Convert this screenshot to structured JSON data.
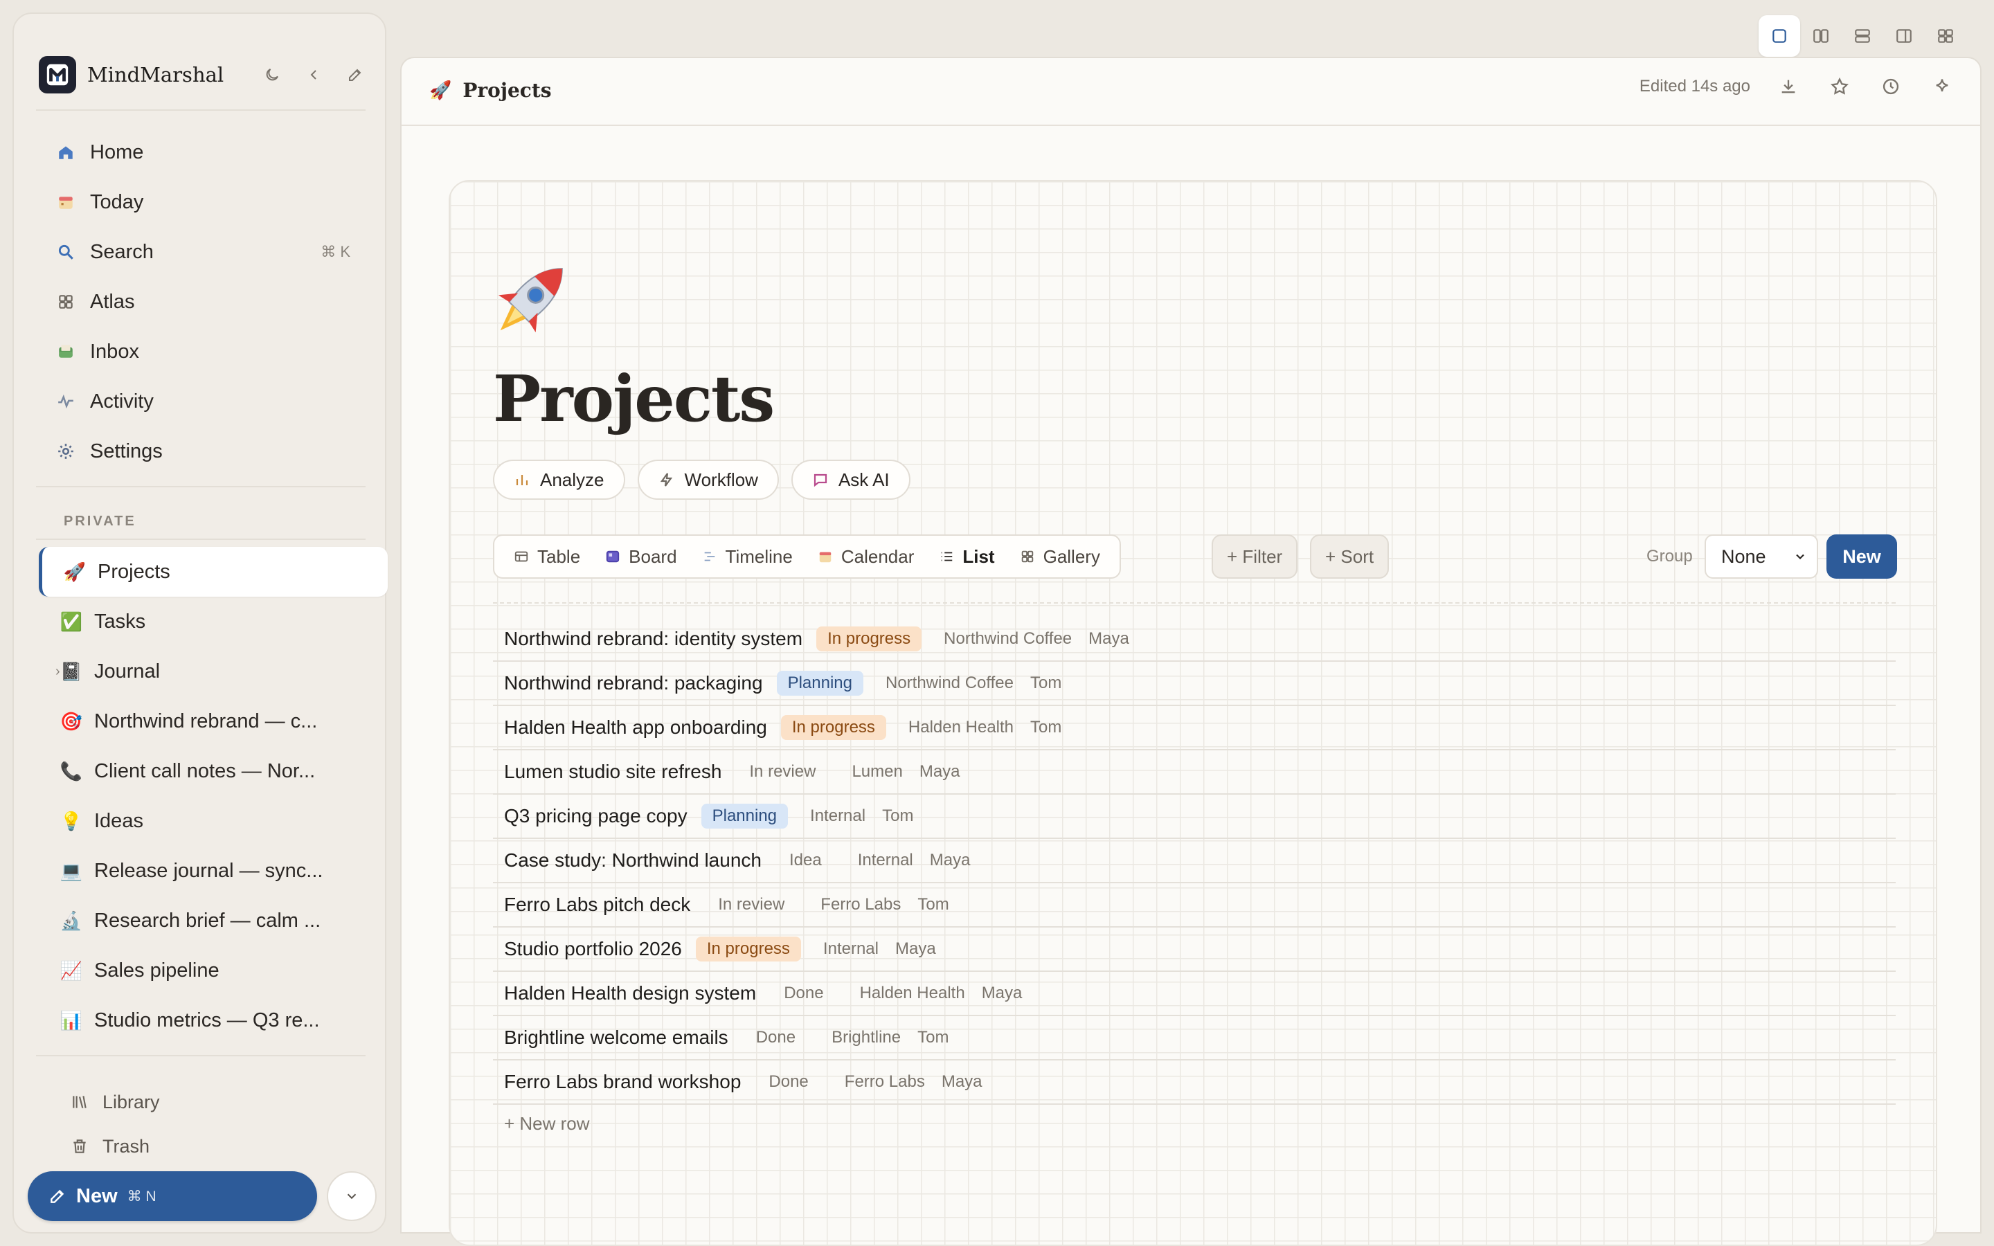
{
  "app": {
    "name": "MindMarshal"
  },
  "sidebar": {
    "nav": [
      {
        "label": "Home",
        "icon": "home-icon"
      },
      {
        "label": "Today",
        "icon": "calendar-icon"
      },
      {
        "label": "Search",
        "icon": "search-icon",
        "shortcut": "⌘ K"
      },
      {
        "label": "Atlas",
        "icon": "grid-icon"
      },
      {
        "label": "Inbox",
        "icon": "inbox-icon"
      },
      {
        "label": "Activity",
        "icon": "activity-icon"
      },
      {
        "label": "Settings",
        "icon": "gear-icon"
      }
    ],
    "section_label": "PRIVATE",
    "pages": [
      {
        "emoji": "🚀",
        "label": "Projects",
        "active": true
      },
      {
        "emoji": "✅",
        "label": "Tasks"
      },
      {
        "emoji": "📓",
        "label": "Journal",
        "expandable": true
      },
      {
        "emoji": "🎯",
        "label": "Northwind rebrand — c..."
      },
      {
        "emoji": "📞",
        "label": "Client call notes — Nor..."
      },
      {
        "emoji": "💡",
        "label": "Ideas"
      },
      {
        "emoji": "💻",
        "label": "Release journal — sync..."
      },
      {
        "emoji": "🔬",
        "label": "Research brief — calm ..."
      },
      {
        "emoji": "📈",
        "label": "Sales pipeline"
      },
      {
        "emoji": "📊",
        "label": "Studio metrics — Q3 re..."
      }
    ],
    "bottom": [
      {
        "label": "Library",
        "icon": "library-icon"
      },
      {
        "label": "Trash",
        "icon": "trash-icon"
      }
    ],
    "new_button": {
      "label": "New",
      "shortcut": "⌘ N"
    }
  },
  "header": {
    "crumb_emoji": "🚀",
    "crumb": "Projects",
    "edited": "Edited 14s ago"
  },
  "page": {
    "title": "Projects",
    "actions": [
      "Analyze",
      "Workflow",
      "Ask AI"
    ],
    "views": [
      {
        "label": "Table",
        "icon": "table-icon"
      },
      {
        "label": "Board",
        "icon": "board-icon"
      },
      {
        "label": "Timeline",
        "icon": "timeline-icon"
      },
      {
        "label": "Calendar",
        "icon": "calendar-icon"
      },
      {
        "label": "List",
        "icon": "list-icon",
        "active": true
      },
      {
        "label": "Gallery",
        "icon": "gallery-icon"
      }
    ],
    "filter_label": "+ Filter",
    "sort_label": "+ Sort",
    "group_label": "Group",
    "group_value": "None",
    "new_label": "New",
    "new_row_label": "+ New row",
    "rows": [
      {
        "title": "Northwind rebrand: identity system",
        "status": "In progress",
        "client": "Northwind Coffee",
        "owner": "Maya"
      },
      {
        "title": "Northwind rebrand: packaging",
        "status": "Planning",
        "client": "Northwind Coffee",
        "owner": "Tom"
      },
      {
        "title": "Halden Health app onboarding",
        "status": "In progress",
        "client": "Halden Health",
        "owner": "Tom"
      },
      {
        "title": "Lumen studio site refresh",
        "status": "In review",
        "client": "Lumen",
        "owner": "Maya"
      },
      {
        "title": "Q3 pricing page copy",
        "status": "Planning",
        "client": "Internal",
        "owner": "Tom"
      },
      {
        "title": "Case study: Northwind launch",
        "status": "Idea",
        "client": "Internal",
        "owner": "Maya"
      },
      {
        "title": "Ferro Labs pitch deck",
        "status": "In review",
        "client": "Ferro Labs",
        "owner": "Tom"
      },
      {
        "title": "Studio portfolio 2026",
        "status": "In progress",
        "client": "Internal",
        "owner": "Maya"
      },
      {
        "title": "Halden Health design system",
        "status": "Done",
        "client": "Halden Health",
        "owner": "Maya"
      },
      {
        "title": "Brightline welcome emails",
        "status": "Done",
        "client": "Brightline",
        "owner": "Tom"
      },
      {
        "title": "Ferro Labs brand workshop",
        "status": "Done",
        "client": "Ferro Labs",
        "owner": "Maya"
      }
    ]
  },
  "colors": {
    "accent": "#2d5b99",
    "in_progress": "#fbe1c8",
    "planning": "#d8e6f7"
  }
}
